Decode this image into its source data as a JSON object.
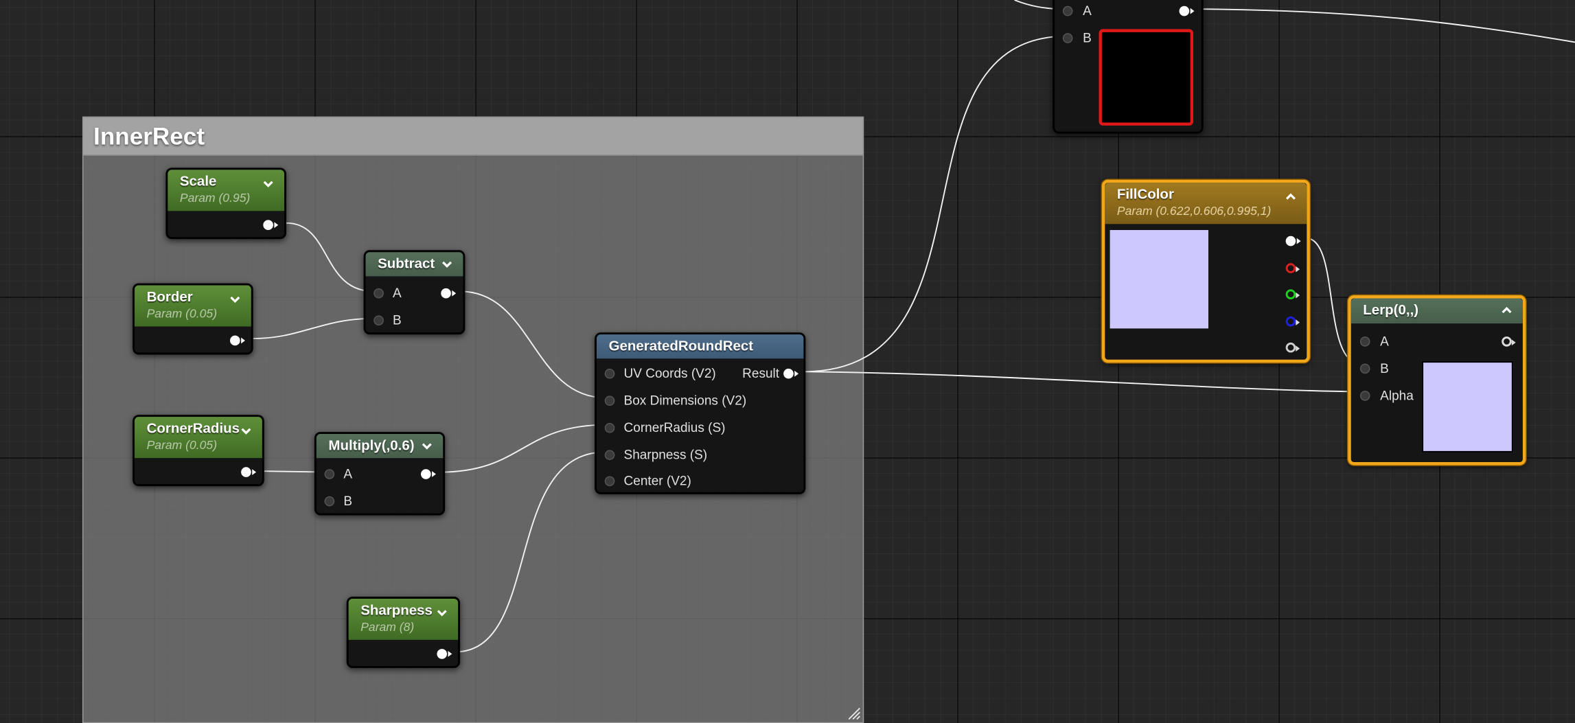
{
  "comment": {
    "title": "InnerRect"
  },
  "nodes": {
    "scale": {
      "title": "Scale",
      "param": "Param (0.95)"
    },
    "border": {
      "title": "Border",
      "param": "Param (0.05)"
    },
    "corner_radius": {
      "title": "CornerRadius",
      "param": "Param (0.05)"
    },
    "sharpness": {
      "title": "Sharpness",
      "param": "Param (8)"
    },
    "subtract": {
      "title": "Subtract",
      "pins": [
        "A",
        "B"
      ]
    },
    "multiply": {
      "title": "Multiply(,0.6)",
      "pins": [
        "A",
        "B"
      ]
    },
    "generated_round_rect": {
      "title": "GeneratedRoundRect",
      "inputs": [
        "UV Coords (V2)",
        "Box Dimensions (V2)",
        "CornerRadius (S)",
        "Sharpness (S)",
        "Center (V2)"
      ],
      "output": "Result"
    },
    "top_node": {
      "pins": [
        "A",
        "B"
      ],
      "preview_color": "#000000",
      "preview_border": "#e01818"
    },
    "fill_color": {
      "title": "FillColor",
      "param": "Param (0.622,0.606,0.995,1)",
      "preview_color": "#cdc9fe"
    },
    "lerp": {
      "title": "Lerp(0,,)",
      "pins": [
        "A",
        "B",
        "Alpha"
      ],
      "preview_color": "#cdc9fe"
    }
  },
  "colors": {
    "selection": "#f2a71b",
    "param_header": "#4c7a2c",
    "function_header": "#3d5a76",
    "vector_param_header": "#7a5c17"
  },
  "icons": {
    "collapse": "chevron-down-icon",
    "expand": "chevron-up-icon",
    "resize": "resize-grip-icon"
  }
}
